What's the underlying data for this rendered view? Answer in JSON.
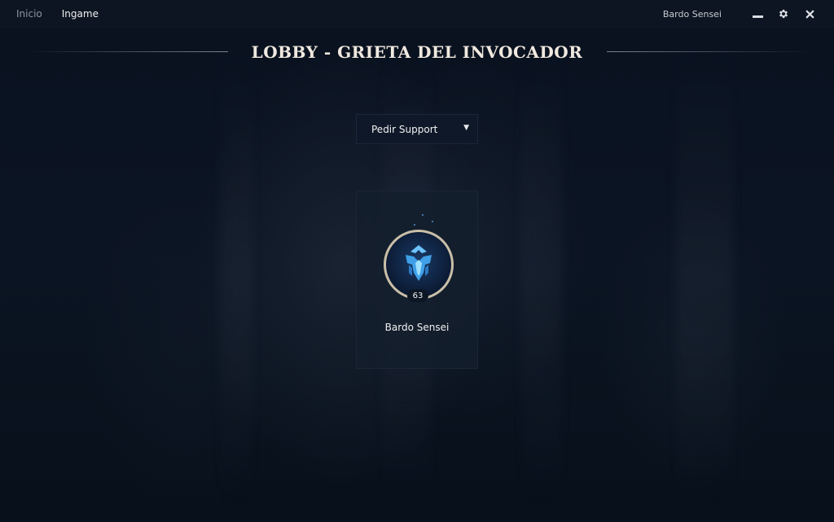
{
  "nav": {
    "items": [
      {
        "label": "Inicio"
      },
      {
        "label": "Ingame"
      }
    ]
  },
  "header": {
    "username": "Bardo Sensei",
    "icons": [
      "minimize-icon",
      "gear-icon",
      "close-icon"
    ]
  },
  "page": {
    "title": "LOBBY - GRIETA DEL INVOCADOR"
  },
  "role_select": {
    "value": "Pedir Support"
  },
  "member": {
    "name": "Bardo Sensei",
    "level": "63",
    "icon": "summoner-icon"
  },
  "colors": {
    "background": "#0b1320",
    "ring": "#c9bfa8",
    "icon_blue": "#3fa0e8"
  }
}
